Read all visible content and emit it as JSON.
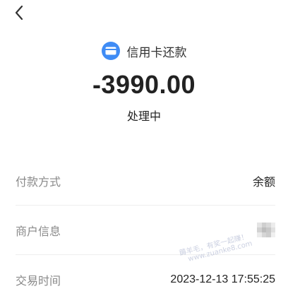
{
  "header": {
    "icon": "credit-card-icon",
    "title": "信用卡还款",
    "amount": "-3990.00",
    "status": "处理中"
  },
  "details": {
    "payment_method_label": "付款方式",
    "payment_method_value": "余额",
    "merchant_label": "商户信息",
    "time_label": "交易时间",
    "time_value": "2023-12-13 17:55:25"
  },
  "watermark": {
    "line1": "薅羊毛，有奖一起赚！",
    "line2": "www.zuanke8.com"
  },
  "colors": {
    "icon_blue": "#3f8cf5",
    "label_gray": "#8a8a8a"
  }
}
